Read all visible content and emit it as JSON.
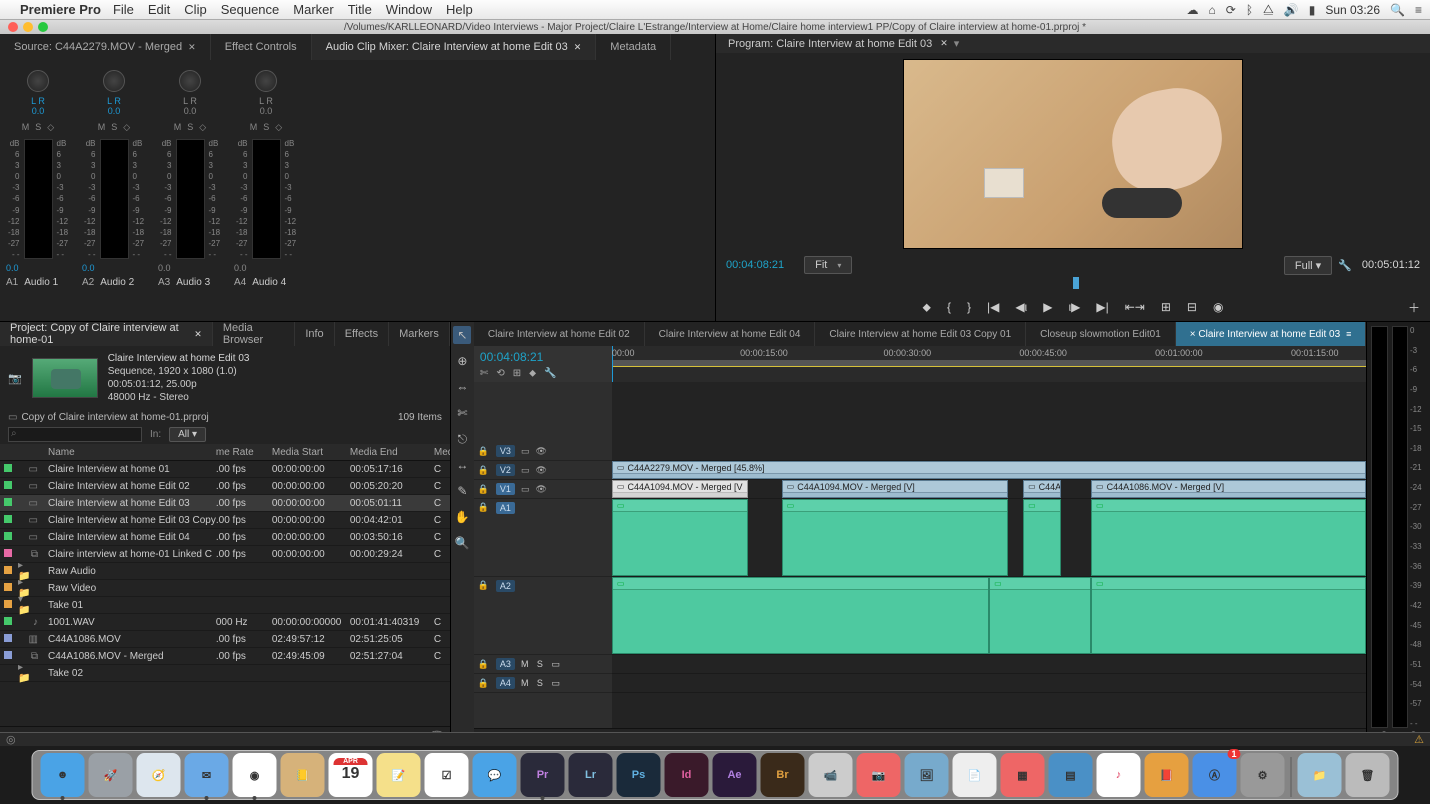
{
  "os": {
    "app_name": "Premiere Pro",
    "menus": [
      "File",
      "Edit",
      "Clip",
      "Sequence",
      "Marker",
      "Title",
      "Window",
      "Help"
    ],
    "clock": "Sun 03:26",
    "title_path": "/Volumes/KARLLEONARD/Video Interviews - Major Project/Claire L'Estrange/Interview at Home/Claire home interview1 PP/Copy of Claire interview at home-01.prproj *"
  },
  "source_panel": {
    "tabs": [
      {
        "label": "Source: C44A2279.MOV - Merged",
        "closable": true
      },
      {
        "label": "Effect Controls"
      },
      {
        "label": "Audio Clip Mixer: Claire Interview at home Edit 03",
        "active": true,
        "closable": true
      },
      {
        "label": "Metadata"
      }
    ],
    "channels": [
      {
        "id": "A1",
        "name": "Audio 1",
        "lr": "L    R",
        "knob": "0.0",
        "fader": "0.0",
        "active": true
      },
      {
        "id": "A2",
        "name": "Audio 2",
        "lr": "L    R",
        "knob": "0.0",
        "fader": "0.0",
        "active": true
      },
      {
        "id": "A3",
        "name": "Audio 3",
        "lr": "L    R",
        "knob": "0.0",
        "fader": "0.0",
        "active": false
      },
      {
        "id": "A4",
        "name": "Audio 4",
        "lr": "L    R",
        "knob": "0.0",
        "fader": "0.0",
        "active": false
      }
    ],
    "db_ticks": [
      "dB",
      "6",
      "3",
      "0",
      "-3",
      "-6",
      "-9",
      "-12",
      "-18",
      "-27",
      "- -"
    ],
    "mso": [
      "M",
      "S",
      "◇"
    ]
  },
  "program_panel": {
    "title": "Program: Claire Interview at home Edit 03",
    "timecode_current": "00:04:08:21",
    "fit_label": "Fit",
    "res_label": "Full",
    "timecode_total": "00:05:01:12",
    "transport_icons": [
      "⬥",
      "{",
      "}",
      "|◀",
      "◀ι",
      "▶",
      "ι▶",
      "▶|",
      "⇤⇥",
      "⊞",
      "⊟",
      "◉"
    ]
  },
  "project_panel": {
    "tabs": [
      {
        "label": "Project: Copy of Claire interview at home-01",
        "active": true,
        "closable": true
      },
      {
        "label": "Media Browser"
      },
      {
        "label": "Info"
      },
      {
        "label": "Effects"
      },
      {
        "label": "Markers"
      }
    ],
    "selected": {
      "name": "Claire Interview at home Edit 03",
      "line2": "Sequence, 1920 x 1080 (1.0)",
      "line3": "00:05:01:12, 25.00p",
      "line4": "48000 Hz - Stereo"
    },
    "proj_file": "Copy of Claire interview at home-01.prproj",
    "item_count": "109 Items",
    "columns": [
      "Name",
      "me Rate",
      "Media Start",
      "Media End",
      "Med"
    ],
    "all_label": "All",
    "in_label": "In:",
    "rows": [
      {
        "chip": "#45c96b",
        "icon": "seq",
        "name": "Claire Interview at home 01",
        "rate": ".00 fps",
        "start": "00:00:00:00",
        "end": "00:05:17:16",
        "m": "C"
      },
      {
        "chip": "#45c96b",
        "icon": "seq",
        "name": "Claire Interview at home Edit 02",
        "rate": ".00 fps",
        "start": "00:00:00:00",
        "end": "00:05:20:20",
        "m": "C"
      },
      {
        "chip": "#45c96b",
        "icon": "seq",
        "name": "Claire Interview at home Edit 03",
        "rate": ".00 fps",
        "start": "00:00:00:00",
        "end": "00:05:01:11",
        "m": "C",
        "selected": true
      },
      {
        "chip": "#45c96b",
        "icon": "seq",
        "name": "Claire Interview at home Edit 03 Copy",
        "rate": ".00 fps",
        "start": "00:00:00:00",
        "end": "00:04:42:01",
        "m": "C"
      },
      {
        "chip": "#45c96b",
        "icon": "seq",
        "name": "Claire Interview at home Edit 04",
        "rate": ".00 fps",
        "start": "00:00:00:00",
        "end": "00:03:50:16",
        "m": "C"
      },
      {
        "chip": "#e86aa6",
        "icon": "link",
        "name": "Claire interview at home-01 Linked C",
        "rate": ".00 fps",
        "start": "00:00:00:00",
        "end": "00:00:29:24",
        "m": "C"
      },
      {
        "chip": "#e6a243",
        "icon": "folder",
        "name": "Raw Audio",
        "folder": true
      },
      {
        "chip": "#e6a243",
        "icon": "folder",
        "name": "Raw Video",
        "folder": true
      },
      {
        "chip": "#e6a243",
        "icon": "folder-open",
        "name": "Take 01",
        "folder": true,
        "open": true
      },
      {
        "chip": "#45c96b",
        "icon": "audio",
        "name": "1001.WAV",
        "rate": "000 Hz",
        "start": "00:00:00:00000",
        "end": "00:01:41:40319",
        "m": "C",
        "indent": true
      },
      {
        "chip": "#8a9dd6",
        "icon": "video",
        "name": "C44A1086.MOV",
        "rate": ".00 fps",
        "start": "02:49:57:12",
        "end": "02:51:25:05",
        "m": "C",
        "indent": true
      },
      {
        "chip": "#8a9dd6",
        "icon": "merge",
        "name": "C44A1086.MOV - Merged",
        "rate": ".00 fps",
        "start": "02:49:45:09",
        "end": "02:51:27:04",
        "m": "C",
        "indent": true
      },
      {
        "chip": "",
        "icon": "folder",
        "name": "Take 02",
        "folder": true
      }
    ]
  },
  "timeline": {
    "tabs": [
      {
        "label": "Claire Interview at home Edit 02"
      },
      {
        "label": "Claire Interview at home Edit 04"
      },
      {
        "label": "Claire Interview at home Edit 03 Copy 01"
      },
      {
        "label": "Closeup slowmotion Edit01"
      },
      {
        "label": "Claire Interview at home Edit 03",
        "active": true,
        "closable": true
      }
    ],
    "current_tc": "00:04:08:21",
    "header_icons": [
      "✄",
      "⟲",
      "⊞",
      "⬥",
      "🔧"
    ],
    "ruler_ticks": [
      {
        "pos": 0,
        "label": "00:00"
      },
      {
        "pos": 0.17,
        "label": "00:00:15:00"
      },
      {
        "pos": 0.36,
        "label": "00:00:30:00"
      },
      {
        "pos": 0.54,
        "label": "00:00:45:00"
      },
      {
        "pos": 0.72,
        "label": "00:01:00:00"
      },
      {
        "pos": 0.9,
        "label": "00:01:15:00"
      }
    ],
    "tracks_video": [
      {
        "id": "V3"
      },
      {
        "id": "V2"
      },
      {
        "id": "V1",
        "selected": true
      }
    ],
    "tracks_audio": [
      {
        "id": "A1",
        "name": "Audio 1",
        "selected": true,
        "tall": true
      },
      {
        "id": "A2",
        "name": "Audio 2",
        "tall": true
      },
      {
        "id": "A3"
      },
      {
        "id": "A4"
      }
    ],
    "clips": {
      "v2": [
        {
          "label": "C44A2279.MOV - Merged [45.8%]",
          "x": 0,
          "w": 1.0
        }
      ],
      "v1": [
        {
          "label": "C44A1094.MOV - Merged [V",
          "x": 0,
          "w": 0.18,
          "sel": true
        },
        {
          "label": "C44A1094.MOV - Merged [V]",
          "x": 0.225,
          "w": 0.3
        },
        {
          "label": "C44A",
          "x": 0.545,
          "w": 0.05
        },
        {
          "label": "C44A1086.MOV - Merged [V]",
          "x": 0.635,
          "w": 0.365
        }
      ],
      "a1": [
        {
          "x": 0,
          "w": 0.18
        },
        {
          "x": 0.225,
          "w": 0.3
        },
        {
          "x": 0.545,
          "w": 0.05
        },
        {
          "x": 0.635,
          "w": 0.365
        }
      ],
      "a2": [
        {
          "x": 0,
          "w": 0.5
        },
        {
          "x": 0.5,
          "w": 0.135
        },
        {
          "x": 0.635,
          "w": 0.365
        }
      ]
    },
    "footer_tc": "0.0"
  },
  "tools": [
    "↖",
    "⊕",
    "⇔",
    "✄",
    "⎋",
    "↔",
    "✎",
    "✋",
    "🔍"
  ],
  "audio_master_ticks": [
    "0",
    "-3",
    "-6",
    "-9",
    "-12",
    "-15",
    "-18",
    "-21",
    "-24",
    "-27",
    "-30",
    "-33",
    "-36",
    "-39",
    "-42",
    "-45",
    "-48",
    "-51",
    "-54",
    "-57",
    "- -"
  ],
  "audio_master_foot": [
    "S",
    "S"
  ],
  "dock": [
    {
      "name": "finder",
      "bg": "#4aa3e6",
      "txt": "☻",
      "running": true
    },
    {
      "name": "launchpad",
      "bg": "#9aa0a6",
      "txt": "🚀"
    },
    {
      "name": "safari",
      "bg": "#dde6ee",
      "txt": "🧭"
    },
    {
      "name": "mail",
      "bg": "#6aa9e6",
      "txt": "✉",
      "running": true
    },
    {
      "name": "chrome",
      "bg": "#fff",
      "txt": "◉",
      "running": true
    },
    {
      "name": "contacts",
      "bg": "#d6b27a",
      "txt": "📒"
    },
    {
      "name": "calendar",
      "bg": "#fff",
      "txt": "19",
      "cal": true
    },
    {
      "name": "notes",
      "bg": "#f5e08a",
      "txt": "📝"
    },
    {
      "name": "reminders",
      "bg": "#fff",
      "txt": "☑"
    },
    {
      "name": "messages",
      "bg": "#4aa3e6",
      "txt": "💬"
    },
    {
      "name": "premiere",
      "bg": "#2a2a3a",
      "txt": "Pr",
      "fg": "#c080e0",
      "running": true
    },
    {
      "name": "lightroom",
      "bg": "#2a2a3a",
      "txt": "Lr",
      "fg": "#80c0e0"
    },
    {
      "name": "photoshop",
      "bg": "#1a2a3a",
      "txt": "Ps",
      "fg": "#60b0e0"
    },
    {
      "name": "indesign",
      "bg": "#3a1a2a",
      "txt": "Id",
      "fg": "#e060a0"
    },
    {
      "name": "aftereffects",
      "bg": "#2a1a3a",
      "txt": "Ae",
      "fg": "#b080e0"
    },
    {
      "name": "bridge",
      "bg": "#3a2a1a",
      "txt": "Br",
      "fg": "#e0a040"
    },
    {
      "name": "facetime",
      "bg": "#ccc",
      "txt": "📹"
    },
    {
      "name": "photobooth",
      "bg": "#e66",
      "txt": "📷"
    },
    {
      "name": "preview",
      "bg": "#7ac",
      "txt": "🖼"
    },
    {
      "name": "textedit",
      "bg": "#eee",
      "txt": "📄"
    },
    {
      "name": "office",
      "bg": "#e66",
      "txt": "▦"
    },
    {
      "name": "keynote",
      "bg": "#4a90c6",
      "txt": "▤"
    },
    {
      "name": "itunes",
      "bg": "#fff",
      "txt": "♪",
      "fg": "#e04060"
    },
    {
      "name": "ibooks",
      "bg": "#e6a040",
      "txt": "📕"
    },
    {
      "name": "appstore",
      "bg": "#4a90e6",
      "txt": "Ⓐ",
      "badge": "1"
    },
    {
      "name": "sysprefs",
      "bg": "#999",
      "txt": "⚙"
    },
    {
      "name": "sep"
    },
    {
      "name": "folder",
      "bg": "#9ac0d6",
      "txt": "📁"
    },
    {
      "name": "trash",
      "bg": "#bbb",
      "txt": "🗑"
    }
  ]
}
